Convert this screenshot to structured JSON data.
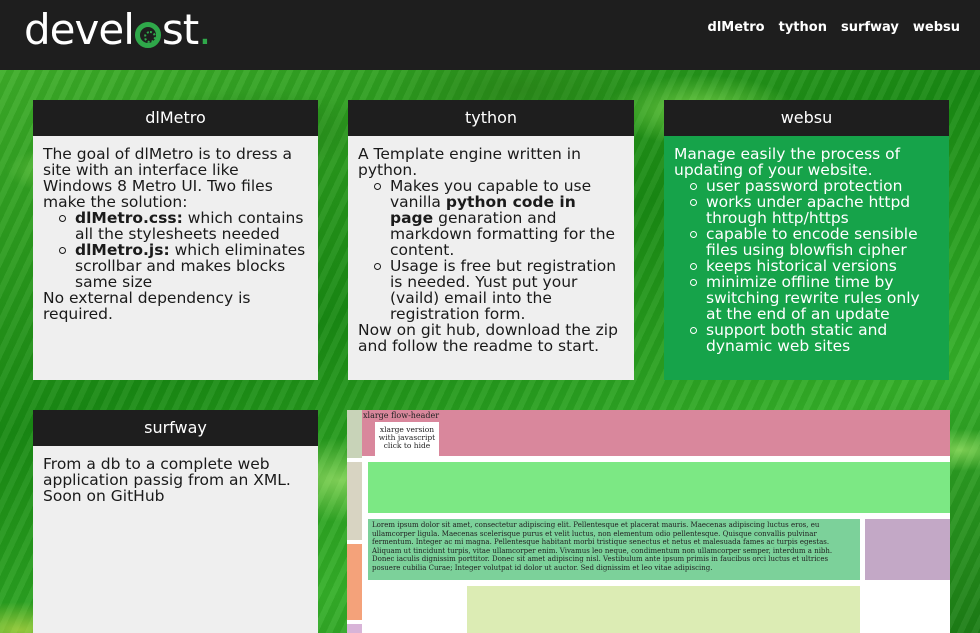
{
  "header": {
    "logo_text": {
      "part1": "devel",
      "part2": "st",
      "dot": "."
    },
    "nav": [
      "dlMetro",
      "tython",
      "surfway",
      "websu"
    ]
  },
  "colors": {
    "topbar": "#1e1e1e",
    "tile_gray": "#efefef",
    "tile_green": "#16a34a",
    "logo_accent": "#2fa84a"
  },
  "tiles": {
    "dlmetro": {
      "title": "dlMetro",
      "intro": "The goal of dlMetro is to dress a site with an interface like Windows 8 Metro UI. Two files make the solution:",
      "items": [
        {
          "name": "dlMetro.css:",
          "text": " which contains all the stylesheets needed"
        },
        {
          "name": "dlMetro.js:",
          "text": " which eliminates scrollbar and makes blocks same size"
        }
      ],
      "outro": "No external dependency is required."
    },
    "tython": {
      "title": "tython",
      "intro": "A Template engine written in python.",
      "item1_pre": "Makes you capable to use vanilla ",
      "item1_bold": "python code in page",
      "item1_post": " genaration and markdown formatting for the content.",
      "item2": "Usage is free but registration is needed. Yust put your (vaild) email into the registration form.",
      "outro": "Now on git hub, download the zip and follow the readme to start."
    },
    "websu": {
      "title": "websu",
      "intro": "Manage easily the process of updating of your website.",
      "items": [
        "user password protection",
        "works under apache httpd through http/https",
        "capable to encode sensible files using blowfish cipher",
        "keeps historical versions",
        "minimize offline time by switching rewrite rules only at the end of an update",
        "support both static and dynamic web sites"
      ]
    },
    "surfway": {
      "title": "surfway",
      "text": "From a db to a complete web application passig from an XML. Soon on GitHub"
    }
  },
  "demo": {
    "header_label": "xlarge flow-header",
    "popup": "xlarge version with javascript click to hide",
    "lorem": "Lorem ipsum dolor sit amet, consectetur adipiscing elit. Pellentesque et placerat mauris. Maecenas adipiscing luctus eros, eu ullamcorper ligula. Maecenas scelerisque purus et velit luctus, non elementum odio pellentesque. Quisque convallis pulvinar fermentum. Integer ac mi magna. Pellentesque habitant morbi tristique senectus et netus et malesuada fames ac turpis egestas. Aliquam ut tincidunt turpis, vitae ullamcorper enim. Vivamus leo neque, condimentum non ullamcorper semper, interdum a nibh. Donec iaculis dignissim porttitor. Donec sit amet adipiscing nisl. Vestibulum ante ipsum primis in faucibus orci luctus et ultrices posuere cubilia Curae; Integer volutpat id dolor ut auctor. Sed dignissim et leo vitae adipiscing."
  }
}
